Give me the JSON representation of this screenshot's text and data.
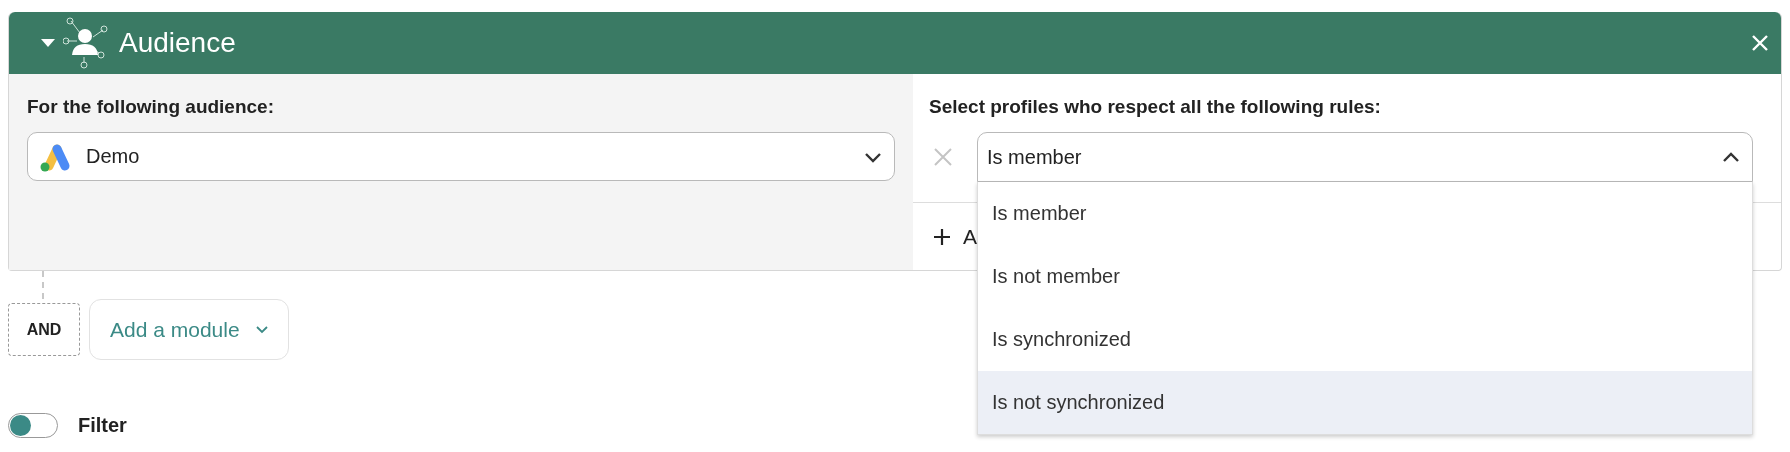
{
  "header": {
    "title": "Audience",
    "expanded": true
  },
  "audience": {
    "label": "For the following audience:",
    "value": "Demo",
    "open": false
  },
  "rules": {
    "label": "Select profiles who respect all the following rules:",
    "rule": {
      "value": "Is member",
      "open": true
    },
    "add_rule": "A",
    "options": [
      {
        "label": "Is member",
        "highlighted": false
      },
      {
        "label": "Is not member",
        "highlighted": false
      },
      {
        "label": "Is synchronized",
        "highlighted": false
      },
      {
        "label": "Is not synchronized",
        "highlighted": true
      }
    ]
  },
  "operator": "AND",
  "add_module": "Add a module",
  "filter": {
    "label": "Filter",
    "on": false
  }
}
